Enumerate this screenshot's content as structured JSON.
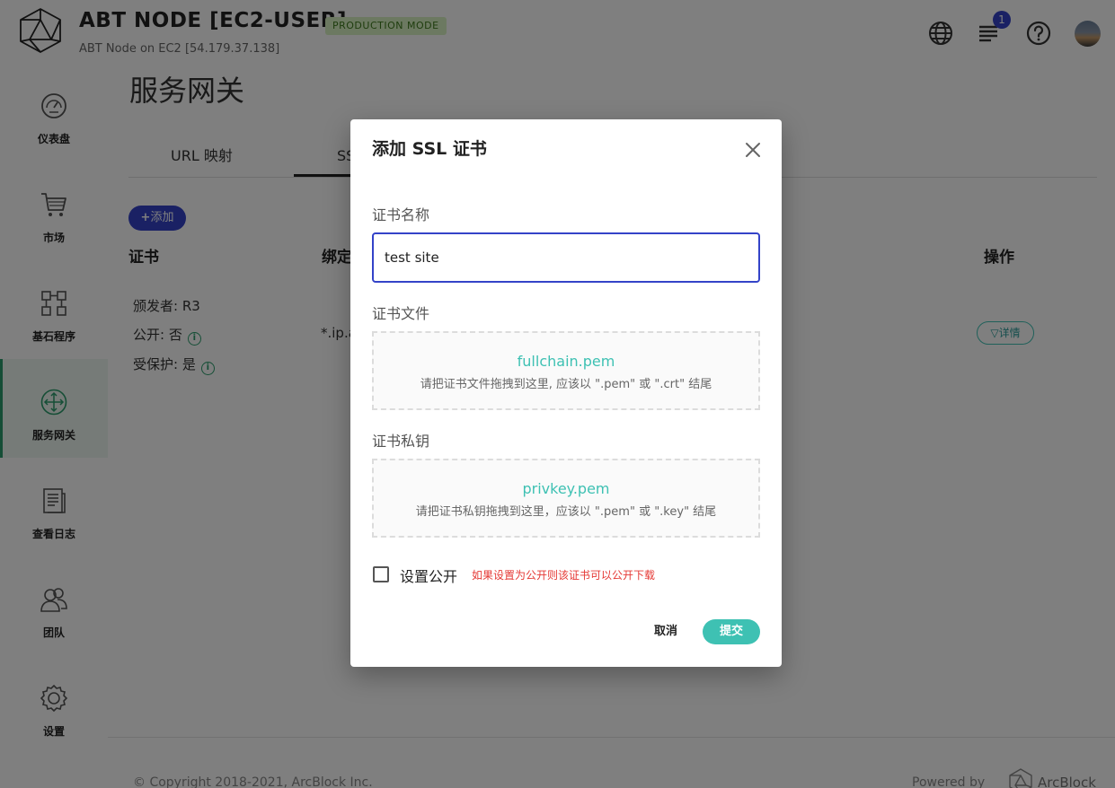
{
  "header": {
    "title": "ABT NODE [EC2-USER]",
    "mode_badge": "PRODUCTION MODE",
    "subtitle": "ABT Node on EC2 [54.179.37.138]",
    "notification_count": "1"
  },
  "sidebar": {
    "items": [
      {
        "label": "仪表盘",
        "icon": "dashboard-icon"
      },
      {
        "label": "市场",
        "icon": "cart-icon"
      },
      {
        "label": "基石程序",
        "icon": "blocklets-icon"
      },
      {
        "label": "服务网关",
        "icon": "gateway-icon",
        "active": true
      },
      {
        "label": "查看日志",
        "icon": "logs-icon"
      },
      {
        "label": "团队",
        "icon": "team-icon"
      },
      {
        "label": "设置",
        "icon": "gear-icon"
      }
    ]
  },
  "main": {
    "page_title": "服务网关",
    "tabs": [
      {
        "label": "URL 映射"
      },
      {
        "label": "SSL 证书",
        "active": true
      }
    ],
    "add_label": "添加",
    "table": {
      "columns": [
        "证书",
        "绑定域名",
        "操作"
      ],
      "row": {
        "issuer": "颁发者: R3",
        "public": "公开: 否",
        "protected": "受保护: 是",
        "domain": "*.ip.abtnet.io",
        "detail_label": "详情"
      }
    },
    "footer": {
      "copyright": "© Copyright 2018-2021, ArcBlock Inc.",
      "powered_by": "Powered by",
      "brand": "ArcBlock"
    }
  },
  "dialog": {
    "title": "添加 SSL 证书",
    "name_label": "证书名称",
    "name_value": "test site",
    "file_label": "证书文件",
    "file_name": "fullchain.pem",
    "file_hint": "请把证书文件拖拽到这里, 应该以 \".pem\" 或 \".crt\" 结尾",
    "key_label": "证书私钥",
    "key_name": "privkey.pem",
    "key_hint": "请把证书私钥拖拽到这里，应该以 \".pem\" 或 \".key\" 结尾",
    "public_label": "设置公开",
    "public_hint": "如果设置为公开则该证书可以公开下载",
    "public_checked": false,
    "cancel_label": "取消",
    "submit_label": "提交"
  },
  "colors": {
    "primary": "#3443c8",
    "accent": "#3ec1b3",
    "active_nav": "#2a9d6c",
    "warning": "#e53935"
  }
}
